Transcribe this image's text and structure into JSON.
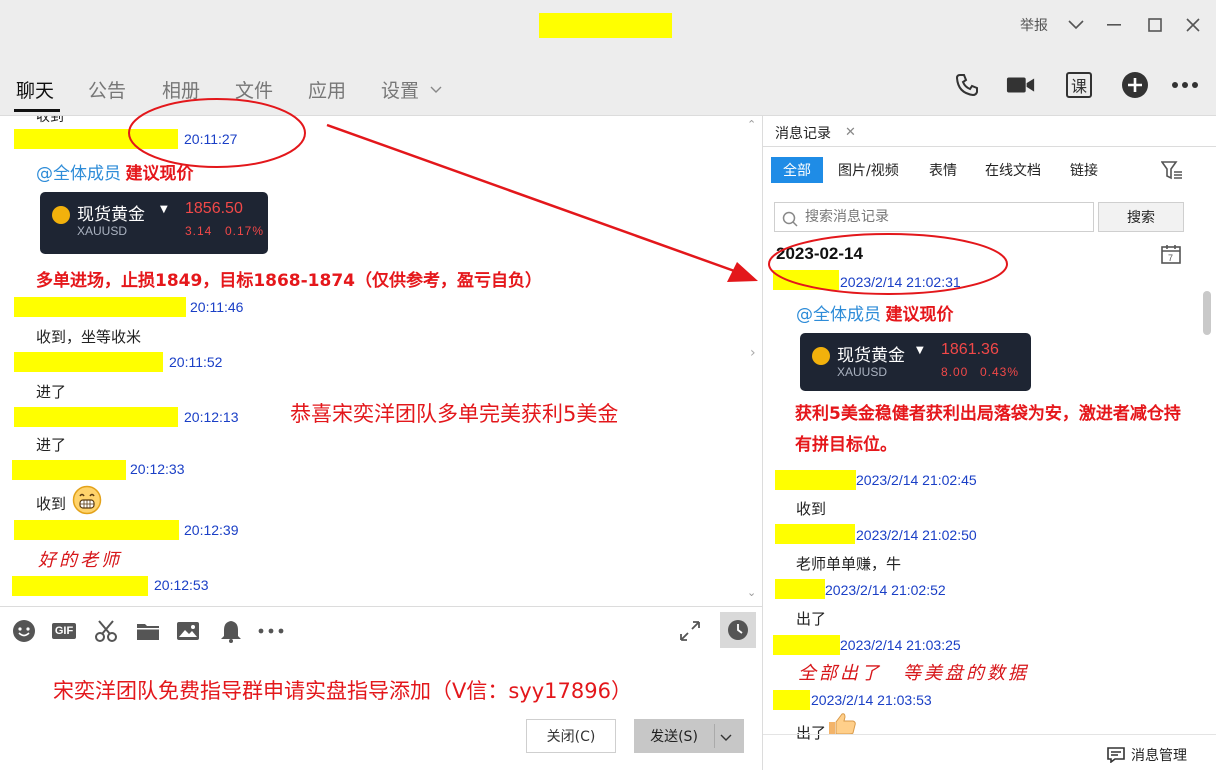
{
  "window": {
    "report_label": "举报",
    "colors": {
      "highlight": "#ffff00",
      "annotation_red": "#e3171b",
      "timestamp_blue": "#1a3fc6",
      "mention_blue": "#2e8cd8"
    }
  },
  "tabs": [
    {
      "label": "聊天"
    },
    {
      "label": "公告"
    },
    {
      "label": "相册"
    },
    {
      "label": "文件"
    },
    {
      "label": "应用"
    },
    {
      "label": "设置"
    }
  ],
  "toolbar": {
    "lesson_label": "课"
  },
  "chat": {
    "top_partial": "收到",
    "messages": [
      {
        "time": "20:11:27"
      },
      {
        "time": "20:11:46",
        "text": "收到，坐等收米"
      },
      {
        "time": "20:11:52",
        "text": "进了"
      },
      {
        "time": "20:12:13",
        "text": "进了"
      },
      {
        "time": "20:12:33",
        "text": "收到"
      },
      {
        "time": "20:12:39",
        "text": "好的老师"
      },
      {
        "time": "20:12:53"
      }
    ],
    "mention": "@全体成员",
    "mention_suffix": "建议现价",
    "gold_card": {
      "name": "现货黄金",
      "code": "XAUUSD",
      "price": "1856.50",
      "change": "3.14",
      "change_pct": "0.17%"
    },
    "signal": "多单进场，止损1849，目标1868-1874（仅供参考，盈亏自负）",
    "annotation": "恭喜宋奕洋团队多单完美获利5美金"
  },
  "input": {
    "gif_label": "GIF",
    "promo": "宋奕洋团队免费指导群申请实盘指导添加（V信：syy17896）",
    "close_label": "关闭(C)",
    "send_label": "发送(S)"
  },
  "history": {
    "tab_label": "消息记录",
    "filters": [
      {
        "label": "全部"
      },
      {
        "label": "图片/视频"
      },
      {
        "label": "表情"
      },
      {
        "label": "在线文档"
      },
      {
        "label": "链接"
      }
    ],
    "search_placeholder": "搜索消息记录",
    "search_button": "搜索",
    "date": "2023-02-14",
    "mention": "@全体成员",
    "mention_suffix": "建议现价",
    "gold_card": {
      "name": "现货黄金",
      "code": "XAUUSD",
      "price": "1861.36",
      "change": "8.00",
      "change_pct": "0.43%"
    },
    "profit_msg": "获利5美金稳健者获利出局落袋为安，激进者减仓持有拼目标位。",
    "entries": [
      {
        "time": "2023/2/14 21:02:31"
      },
      {
        "time": "2023/2/14 21:02:45",
        "text": "收到"
      },
      {
        "time": "2023/2/14 21:02:50",
        "text": "老师单单赚，牛"
      },
      {
        "time": "2023/2/14 21:02:52",
        "text": "出了"
      },
      {
        "time": "2023/2/14 21:03:25",
        "text": "全部出了　等美盘的数据"
      },
      {
        "time": "2023/2/14 21:03:53",
        "text": "出了"
      }
    ],
    "manager_label": "消息管理"
  }
}
